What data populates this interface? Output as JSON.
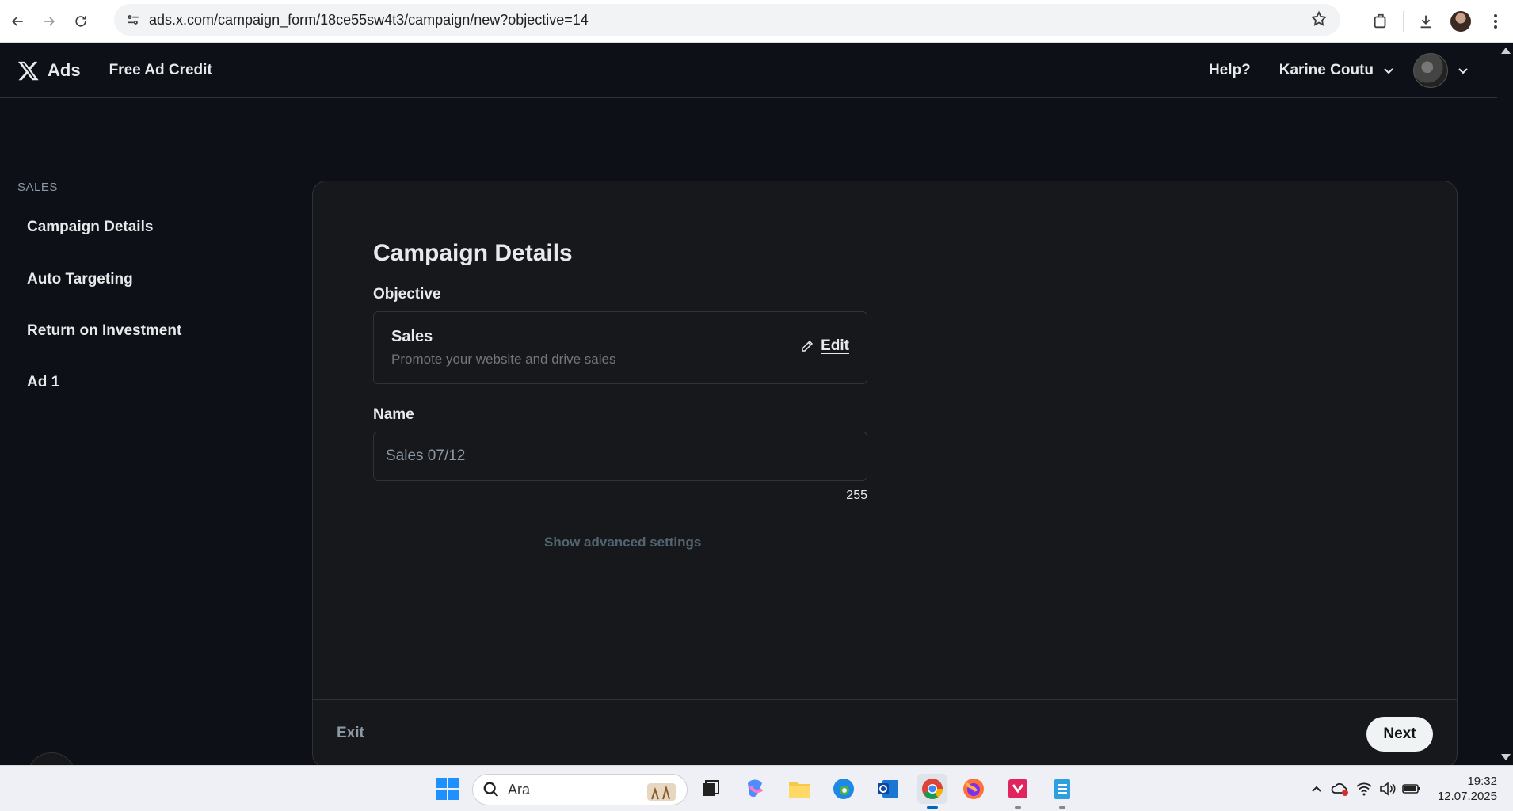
{
  "browser": {
    "url": "ads.x.com/campaign_form/18ce55sw4t3/campaign/new?objective=14"
  },
  "topbar": {
    "logo_text": "Ads",
    "free_credit": "Free Ad Credit",
    "help": "Help?",
    "user_name": "Karine Coutu"
  },
  "sidebar": {
    "section": "SALES",
    "items": [
      {
        "label": "Campaign Details"
      },
      {
        "label": "Auto Targeting"
      },
      {
        "label": "Return on Investment"
      },
      {
        "label": "Ad 1"
      }
    ]
  },
  "main": {
    "title": "Campaign Details",
    "objective_label": "Objective",
    "objective": {
      "title": "Sales",
      "description": "Promote your website and drive sales",
      "edit_label": "Edit"
    },
    "name_label": "Name",
    "name_value": "Sales 07/12",
    "char_count": "255",
    "advanced_link": "Show advanced settings",
    "exit_label": "Exit",
    "next_label": "Next"
  },
  "taskbar": {
    "search_placeholder": "Ara",
    "time": "19:32",
    "date": "12.07.2025"
  },
  "colors": {
    "page_bg": "#0d1117",
    "card_bg": "#16181c",
    "border": "#2f3336",
    "text": "#e7e9ea",
    "muted": "#71767b"
  }
}
